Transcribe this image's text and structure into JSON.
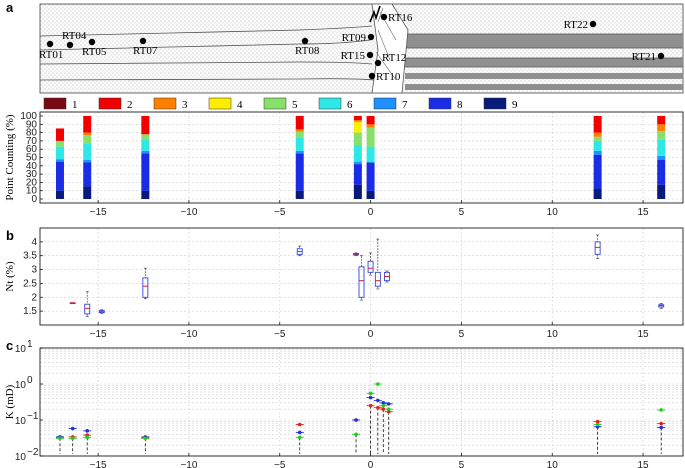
{
  "panel_labels": {
    "a": "a",
    "b": "b",
    "c": "c"
  },
  "map_wells": [
    {
      "name": "RT01"
    },
    {
      "name": "RT04"
    },
    {
      "name": "RT05"
    },
    {
      "name": "RT07"
    },
    {
      "name": "RT08"
    },
    {
      "name": "RT09"
    },
    {
      "name": "RT15"
    },
    {
      "name": "RT12"
    },
    {
      "name": "RT10"
    },
    {
      "name": "RT16"
    },
    {
      "name": "RT22"
    },
    {
      "name": "RT21"
    }
  ],
  "legend": [
    "1",
    "2",
    "3",
    "4",
    "5",
    "6",
    "7",
    "8",
    "9"
  ],
  "colors": [
    "#7a0a14",
    "#f20000",
    "#ff7f00",
    "#ffee00",
    "#88e06a",
    "#2ee8e8",
    "#1e90ff",
    "#1a2ce6",
    "#0a1a7a"
  ],
  "chart_data": [
    {
      "type": "bar",
      "stacked": true,
      "ylabel": "Point Counting (%)",
      "ylim": [
        0,
        100
      ],
      "yticks": [
        0,
        10,
        20,
        30,
        40,
        50,
        60,
        70,
        80,
        90,
        100
      ],
      "xlim": [
        -18.2,
        17.2
      ],
      "xticks": [
        -15,
        -10,
        -5,
        0,
        5,
        10,
        15
      ],
      "grid": true,
      "bars": [
        {
          "x": -17.1,
          "values": [
            0,
            15,
            0,
            0,
            7,
            15,
            3,
            35,
            10
          ]
        },
        {
          "x": -15.6,
          "values": [
            0,
            20,
            3,
            0,
            10,
            20,
            3,
            29,
            15
          ]
        },
        {
          "x": -12.4,
          "values": [
            0,
            22,
            0,
            0,
            7,
            13,
            3,
            45,
            10
          ]
        },
        {
          "x": -3.9,
          "values": [
            0,
            16,
            3,
            0,
            7,
            16,
            3,
            45,
            10
          ]
        },
        {
          "x": -0.7,
          "values": [
            0,
            5,
            2,
            13,
            15,
            20,
            3,
            25,
            17
          ]
        },
        {
          "x": 0,
          "values": [
            0,
            10,
            4,
            0,
            23,
            19,
            0,
            34,
            10
          ]
        },
        {
          "x": 12.5,
          "values": [
            0,
            20,
            5,
            0,
            5,
            12,
            5,
            41,
            12
          ]
        },
        {
          "x": 16,
          "values": [
            0,
            10,
            8,
            0,
            10,
            20,
            5,
            30,
            17
          ]
        }
      ]
    },
    {
      "type": "box",
      "ylabel": "Nt (%)",
      "ylim": [
        1,
        4.5
      ],
      "yticks": [
        1.5,
        2,
        2.5,
        3,
        3.5,
        4
      ],
      "xlim": [
        -18.2,
        17.2
      ],
      "xticks": [
        -15,
        -10,
        -5,
        0,
        5,
        10,
        15
      ],
      "grid": true,
      "boxes": [
        {
          "x": -16.4,
          "min": 1.8,
          "q1": 1.8,
          "median": 1.8,
          "q3": 1.8,
          "max": 1.8
        },
        {
          "x": -15.6,
          "min": 1.3,
          "q1": 1.4,
          "median": 1.6,
          "q3": 1.75,
          "max": 2.2
        },
        {
          "x": -14.8,
          "min": 1.42,
          "q1": 1.45,
          "median": 1.48,
          "q3": 1.52,
          "max": 1.55
        },
        {
          "x": -12.4,
          "min": 1.95,
          "q1": 2.0,
          "median": 2.4,
          "q3": 2.7,
          "max": 3.05
        },
        {
          "x": -3.9,
          "min": 3.5,
          "q1": 3.55,
          "median": 3.65,
          "q3": 3.75,
          "max": 3.85
        },
        {
          "x": -0.8,
          "min": 3.5,
          "q1": 3.53,
          "median": 3.56,
          "q3": 3.58,
          "max": 3.6
        },
        {
          "x": -0.5,
          "min": 1.9,
          "q1": 2.0,
          "median": 2.6,
          "q3": 3.1,
          "max": 3.5
        },
        {
          "x": 0,
          "min": 2.8,
          "q1": 2.9,
          "median": 3.05,
          "q3": 3.3,
          "max": 3.6
        },
        {
          "x": 0.4,
          "min": 2.3,
          "q1": 2.4,
          "median": 2.6,
          "q3": 2.9,
          "max": 4.1
        },
        {
          "x": 0.9,
          "min": 2.55,
          "q1": 2.6,
          "median": 2.75,
          "q3": 2.9,
          "max": 2.95
        },
        {
          "x": 12.5,
          "min": 3.4,
          "q1": 3.55,
          "median": 3.8,
          "q3": 4.0,
          "max": 4.25
        },
        {
          "x": 16,
          "min": 1.6,
          "q1": 1.65,
          "median": 1.7,
          "q3": 1.73,
          "max": 1.78
        }
      ]
    },
    {
      "type": "scatter",
      "ylabel": "K (mD)",
      "yscale": "log",
      "ylim": [
        0.01,
        10
      ],
      "yticks": [
        0.01,
        0.1,
        1,
        10
      ],
      "xlim": [
        -18.2,
        17.2
      ],
      "xticks": [
        -15,
        -10,
        -5,
        0,
        5,
        10,
        15
      ],
      "grid": true,
      "point_colors": {
        "red": "#e8201e",
        "blue": "#2233dd",
        "green": "#22cc22"
      },
      "groups": [
        {
          "x": -17.1,
          "points": [
            {
              "c": "red",
              "y": 0.033
            },
            {
              "c": "blue",
              "y": 0.034
            },
            {
              "c": "green",
              "y": 0.031
            }
          ]
        },
        {
          "x": -16.4,
          "points": [
            {
              "c": "red",
              "y": 0.034
            },
            {
              "c": "blue",
              "y": 0.058
            },
            {
              "c": "green",
              "y": 0.031
            }
          ]
        },
        {
          "x": -15.6,
          "points": [
            {
              "c": "red",
              "y": 0.038
            },
            {
              "c": "blue",
              "y": 0.05
            },
            {
              "c": "green",
              "y": 0.033
            }
          ]
        },
        {
          "x": -12.4,
          "points": [
            {
              "c": "red",
              "y": 0.034
            },
            {
              "c": "blue",
              "y": 0.033
            },
            {
              "c": "green",
              "y": 0.031
            }
          ]
        },
        {
          "x": -3.9,
          "points": [
            {
              "c": "red",
              "y": 0.075
            },
            {
              "c": "blue",
              "y": 0.045
            },
            {
              "c": "green",
              "y": 0.033
            }
          ]
        },
        {
          "x": -0.8,
          "points": [
            {
              "c": "red",
              "y": 0.1
            },
            {
              "c": "blue",
              "y": 0.1
            },
            {
              "c": "green",
              "y": 0.04
            }
          ]
        },
        {
          "x": 0,
          "points": [
            {
              "c": "red",
              "y": 0.25
            },
            {
              "c": "blue",
              "y": 0.42
            },
            {
              "c": "green",
              "y": 0.55
            }
          ]
        },
        {
          "x": 0.4,
          "points": [
            {
              "c": "red",
              "y": 0.22
            },
            {
              "c": "blue",
              "y": 0.35
            },
            {
              "c": "green",
              "y": 1.0
            }
          ]
        },
        {
          "x": 0.7,
          "points": [
            {
              "c": "red",
              "y": 0.2
            },
            {
              "c": "blue",
              "y": 0.3
            },
            {
              "c": "green",
              "y": 0.25
            }
          ]
        },
        {
          "x": 1.0,
          "points": [
            {
              "c": "red",
              "y": 0.17
            },
            {
              "c": "blue",
              "y": 0.28
            },
            {
              "c": "green",
              "y": 0.2
            }
          ]
        },
        {
          "x": 12.5,
          "points": [
            {
              "c": "red",
              "y": 0.09
            },
            {
              "c": "blue",
              "y": 0.065
            },
            {
              "c": "green",
              "y": 0.075
            }
          ]
        },
        {
          "x": 16,
          "points": [
            {
              "c": "red",
              "y": 0.08
            },
            {
              "c": "blue",
              "y": 0.062
            },
            {
              "c": "green",
              "y": 0.19
            }
          ]
        }
      ]
    }
  ]
}
